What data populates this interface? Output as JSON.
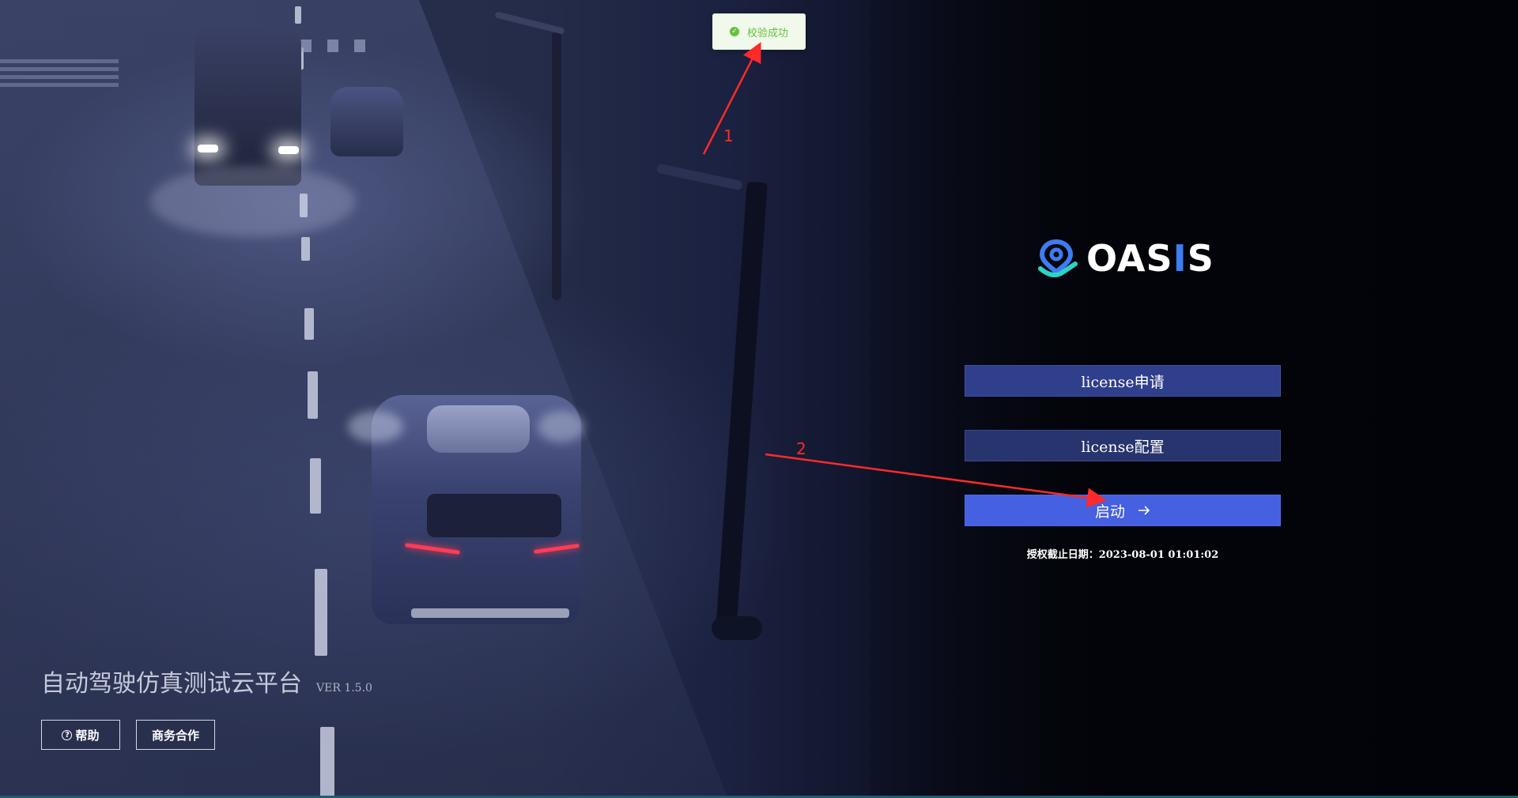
{
  "toast": {
    "message": "校验成功",
    "icon": "check-circle-icon",
    "color": "#67c23a"
  },
  "logo": {
    "text_before_accent": "OAS",
    "text_accent": "I",
    "text_after_accent": "S",
    "icon": "location-pin-icon"
  },
  "actions": {
    "license_apply_label": "license申请",
    "license_config_label": "license配置",
    "start_label": "启动",
    "start_icon": "arrow-right-icon"
  },
  "license": {
    "expiry_text": "授权截止日期：2023-08-01 01:01:02"
  },
  "platform": {
    "title": "自动驾驶仿真测试云平台",
    "version": "VER 1.5.0"
  },
  "footer_buttons": {
    "help_label": "帮助",
    "help_icon": "question-circle-icon",
    "business_label": "商务合作"
  },
  "annotations": {
    "label_1": "1",
    "label_2": "2",
    "color": "#ff2a2a"
  },
  "colors": {
    "primary_button": "#4560e0",
    "secondary_button": "#2f3f8c",
    "logo_accent": "#3d7cf2"
  }
}
